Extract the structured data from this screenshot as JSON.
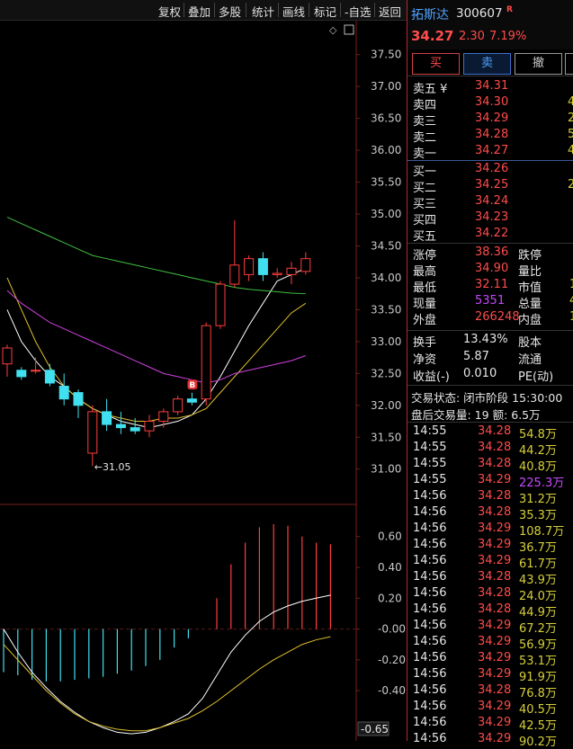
{
  "toolbar": {
    "items": [
      "复权",
      "叠加",
      "多股",
      "统计",
      "画线",
      "标记",
      "-自选",
      "返回"
    ]
  },
  "stock": {
    "name": "拓斯达",
    "code": "300607",
    "badge": "R",
    "price": "34.27",
    "change": "2.30",
    "pct": "7.19%"
  },
  "actions": {
    "buy": "买",
    "sell": "卖",
    "cancel": "撤"
  },
  "orderbook": {
    "asks": [
      {
        "label": "卖五 ¥",
        "price": "34.31",
        "vol": ""
      },
      {
        "label": "卖四",
        "price": "34.30",
        "vol": "4"
      },
      {
        "label": "卖三",
        "price": "34.29",
        "vol": "2"
      },
      {
        "label": "卖二",
        "price": "34.28",
        "vol": "5"
      },
      {
        "label": "卖一",
        "price": "34.27",
        "vol": "4"
      }
    ],
    "bids": [
      {
        "label": "买一",
        "price": "34.26",
        "vol": ""
      },
      {
        "label": "买二",
        "price": "34.25",
        "vol": "2"
      },
      {
        "label": "买三",
        "price": "34.24",
        "vol": ""
      },
      {
        "label": "买四",
        "price": "34.23",
        "vol": ""
      },
      {
        "label": "买五",
        "price": "34.22",
        "vol": ""
      }
    ]
  },
  "stats": [
    {
      "l1": "涨停",
      "v1": "38.36",
      "c1": "red",
      "l2": "跌停",
      "v2": ""
    },
    {
      "l1": "最高",
      "v1": "34.90",
      "c1": "red",
      "l2": "量比",
      "v2": ""
    },
    {
      "l1": "最低",
      "v1": "32.11",
      "c1": "red",
      "l2": "市值",
      "v2": "1"
    },
    {
      "l1": "现量",
      "v1": "5351",
      "c1": "purple",
      "l2": "总量",
      "v2": "4"
    },
    {
      "l1": "外盘",
      "v1": "266248",
      "c1": "red",
      "l2": "内盘",
      "v2": "1"
    }
  ],
  "stats2": [
    {
      "l1": "换手",
      "v1": "13.43%",
      "l2": "股本"
    },
    {
      "l1": "净资",
      "v1": "5.87",
      "l2": "流通"
    },
    {
      "l1": "收益(-)",
      "v1": "0.010",
      "l2": "PE(动)"
    }
  ],
  "trade_status": "交易状态: 闭市阶段 15:30:00",
  "after_hours": "盘后交易量: 19  额: 6.5万",
  "ticks": [
    {
      "t": "14:55",
      "p": "34.28",
      "v": "54.8万",
      "c": "yellow"
    },
    {
      "t": "14:55",
      "p": "34.28",
      "v": "44.2万",
      "c": "yellow"
    },
    {
      "t": "14:55",
      "p": "34.28",
      "v": "40.8万",
      "c": "yellow"
    },
    {
      "t": "14:55",
      "p": "34.29",
      "v": "225.3万",
      "c": "purple"
    },
    {
      "t": "14:56",
      "p": "34.28",
      "v": "31.2万",
      "c": "yellow"
    },
    {
      "t": "14:56",
      "p": "34.28",
      "v": "35.3万",
      "c": "yellow"
    },
    {
      "t": "14:56",
      "p": "34.29",
      "v": "108.7万",
      "c": "yellow"
    },
    {
      "t": "14:56",
      "p": "34.29",
      "v": "36.7万",
      "c": "yellow"
    },
    {
      "t": "14:56",
      "p": "34.29",
      "v": "61.7万",
      "c": "yellow"
    },
    {
      "t": "14:56",
      "p": "34.28",
      "v": "43.9万",
      "c": "yellow"
    },
    {
      "t": "14:56",
      "p": "34.28",
      "v": "24.0万",
      "c": "yellow"
    },
    {
      "t": "14:56",
      "p": "34.28",
      "v": "44.9万",
      "c": "yellow"
    },
    {
      "t": "14:56",
      "p": "34.29",
      "v": "67.2万",
      "c": "yellow"
    },
    {
      "t": "14:56",
      "p": "34.29",
      "v": "56.9万",
      "c": "yellow"
    },
    {
      "t": "14:56",
      "p": "34.29",
      "v": "53.1万",
      "c": "yellow"
    },
    {
      "t": "14:56",
      "p": "34.29",
      "v": "91.9万",
      "c": "yellow"
    },
    {
      "t": "14:56",
      "p": "34.28",
      "v": "76.8万",
      "c": "yellow"
    },
    {
      "t": "14:56",
      "p": "34.29",
      "v": "40.5万",
      "c": "yellow"
    },
    {
      "t": "14:56",
      "p": "34.29",
      "v": "42.5万",
      "c": "yellow"
    },
    {
      "t": "14:56",
      "p": "34.29",
      "v": "90.2万",
      "c": "yellow"
    }
  ],
  "chart_data": {
    "type": "candlestick",
    "price_axis": [
      37.5,
      37.0,
      36.5,
      36.0,
      35.5,
      35.0,
      34.5,
      34.0,
      33.5,
      33.0,
      32.5,
      32.0,
      31.5,
      31.0
    ],
    "ylim": [
      30.7,
      37.75
    ],
    "candles": [
      {
        "o": 32.65,
        "h": 32.95,
        "l": 32.45,
        "c": 32.9
      },
      {
        "o": 32.55,
        "h": 32.6,
        "l": 32.4,
        "c": 32.45
      },
      {
        "o": 32.55,
        "h": 32.75,
        "l": 32.5,
        "c": 32.55
      },
      {
        "o": 32.55,
        "h": 32.65,
        "l": 32.3,
        "c": 32.35
      },
      {
        "o": 32.3,
        "h": 32.5,
        "l": 32.0,
        "c": 32.1
      },
      {
        "o": 32.2,
        "h": 32.25,
        "l": 31.8,
        "c": 32.0
      },
      {
        "o": 31.25,
        "h": 32.0,
        "l": 31.05,
        "c": 31.9
      },
      {
        "o": 31.9,
        "h": 32.1,
        "l": 31.6,
        "c": 31.7
      },
      {
        "o": 31.7,
        "h": 31.9,
        "l": 31.55,
        "c": 31.65
      },
      {
        "o": 31.65,
        "h": 31.8,
        "l": 31.55,
        "c": 31.6
      },
      {
        "o": 31.6,
        "h": 31.85,
        "l": 31.5,
        "c": 31.75
      },
      {
        "o": 31.75,
        "h": 31.95,
        "l": 31.65,
        "c": 31.9
      },
      {
        "o": 31.9,
        "h": 32.15,
        "l": 31.85,
        "c": 32.1
      },
      {
        "o": 32.1,
        "h": 32.2,
        "l": 32.0,
        "c": 32.05
      },
      {
        "o": 32.1,
        "h": 33.3,
        "l": 32.0,
        "c": 33.25
      },
      {
        "o": 33.25,
        "h": 33.95,
        "l": 33.2,
        "c": 33.9
      },
      {
        "o": 33.9,
        "h": 34.9,
        "l": 33.85,
        "c": 34.2
      },
      {
        "o": 34.05,
        "h": 34.35,
        "l": 33.95,
        "c": 34.3
      },
      {
        "o": 34.3,
        "h": 34.4,
        "l": 33.95,
        "c": 34.05
      },
      {
        "o": 34.05,
        "h": 34.15,
        "l": 34.0,
        "c": 34.07
      },
      {
        "o": 34.05,
        "h": 34.25,
        "l": 33.9,
        "c": 34.15
      },
      {
        "o": 34.1,
        "h": 34.4,
        "l": 34.05,
        "c": 34.3
      }
    ],
    "ma": [
      {
        "name": "MA5",
        "color": "#ffffff",
        "values": [
          33.5,
          33.0,
          32.7,
          32.45,
          32.3,
          32.1,
          31.95,
          31.85,
          31.75,
          31.7,
          31.65,
          31.7,
          31.75,
          31.85,
          32.1,
          32.45,
          32.85,
          33.25,
          33.6,
          33.95,
          34.05,
          34.15
        ]
      },
      {
        "name": "MA10",
        "color": "#e0c030",
        "values": [
          34.0,
          33.5,
          33.0,
          32.6,
          32.3,
          32.1,
          31.95,
          31.85,
          31.8,
          31.75,
          31.75,
          31.8,
          31.8,
          31.85,
          31.95,
          32.2,
          32.45,
          32.7,
          32.95,
          33.2,
          33.45,
          33.6
        ]
      },
      {
        "name": "MA20",
        "color": "#d040e0",
        "values": [
          33.8,
          33.6,
          33.45,
          33.3,
          33.2,
          33.1,
          33.0,
          32.9,
          32.8,
          32.7,
          32.6,
          32.5,
          32.45,
          32.4,
          32.35,
          32.4,
          32.5,
          32.55,
          32.6,
          32.65,
          32.7,
          32.78
        ]
      },
      {
        "name": "MA60",
        "color": "#40c040",
        "values": [
          34.95,
          34.85,
          34.75,
          34.65,
          34.55,
          34.45,
          34.35,
          34.3,
          34.25,
          34.2,
          34.15,
          34.1,
          34.05,
          34.0,
          33.95,
          33.9,
          33.85,
          33.82,
          33.8,
          33.78,
          33.76,
          33.75
        ]
      }
    ],
    "low_label": "←31.05",
    "b_marker": "B",
    "macd_axis": [
      "0.60",
      "0.40",
      "0.20",
      "-0.00",
      "-0.20",
      "-0.40"
    ],
    "macd_axis_values": [
      0.6,
      0.4,
      0.2,
      0.0,
      -0.2,
      -0.4
    ],
    "macd_ylim": [
      -0.72,
      0.68
    ],
    "macd_current": "-0.65",
    "macd_hist": [
      -0.28,
      -0.3,
      -0.33,
      -0.34,
      -0.34,
      -0.33,
      -0.32,
      -0.31,
      -0.29,
      -0.27,
      -0.24,
      -0.2,
      -0.12,
      -0.06,
      0.0,
      0.2,
      0.42,
      0.56,
      0.66,
      0.68,
      0.67,
      0.6,
      0.56,
      0.55
    ],
    "macd_dif": [
      -0.0,
      -0.15,
      -0.28,
      -0.38,
      -0.47,
      -0.54,
      -0.6,
      -0.64,
      -0.67,
      -0.68,
      -0.67,
      -0.64,
      -0.6,
      -0.55,
      -0.45,
      -0.3,
      -0.15,
      -0.04,
      0.05,
      0.11,
      0.15,
      0.18,
      0.2,
      0.22
    ],
    "macd_dea": [
      -0.1,
      -0.2,
      -0.3,
      -0.4,
      -0.48,
      -0.55,
      -0.6,
      -0.63,
      -0.65,
      -0.66,
      -0.66,
      -0.64,
      -0.61,
      -0.58,
      -0.53,
      -0.47,
      -0.4,
      -0.33,
      -0.26,
      -0.2,
      -0.15,
      -0.1,
      -0.07,
      -0.05
    ]
  }
}
